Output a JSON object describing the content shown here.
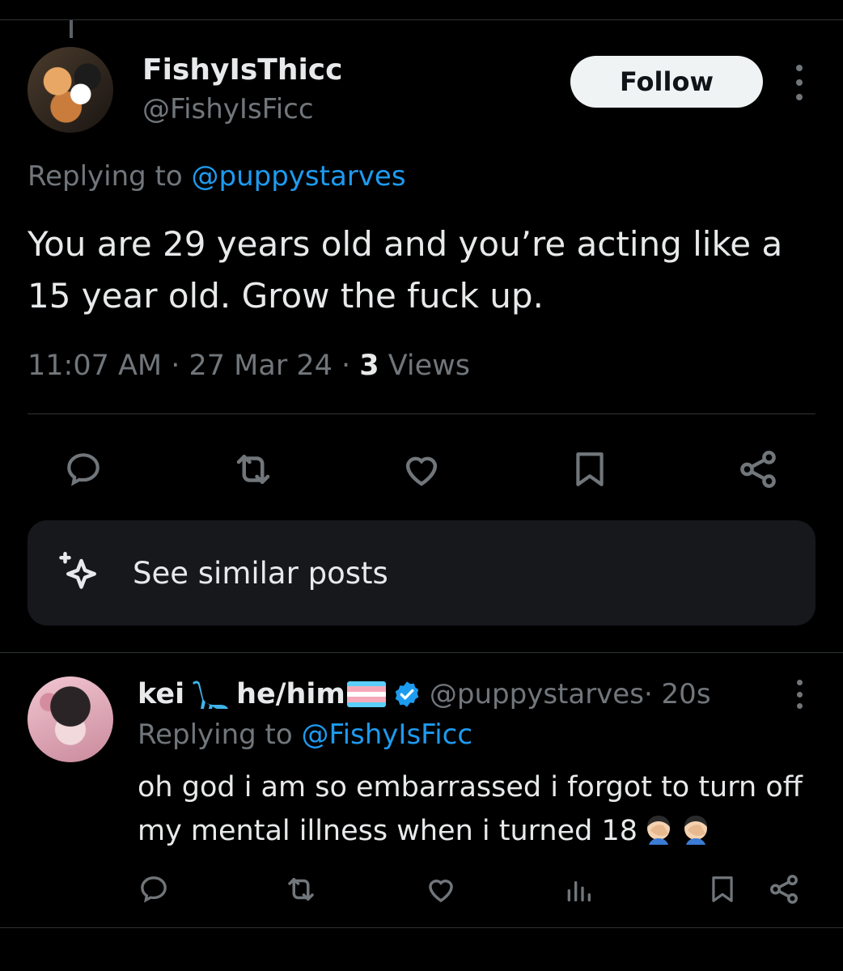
{
  "tweet": {
    "display_name": "FishyIsThicc",
    "handle": "@FishyIsFicc",
    "follow_label": "Follow",
    "replying_prefix": "Replying to ",
    "replying_to": "@puppystarves",
    "text": "You are 29 years old and you’re acting like a 15 year old. Grow the fuck up.",
    "time": "11:07 AM · 27 Mar 24 · ",
    "views_count": "3",
    "views_label": " Views"
  },
  "actions": {
    "icons": [
      "reply-icon",
      "retweet-icon",
      "like-icon",
      "bookmark-icon",
      "share-icon"
    ]
  },
  "similar": {
    "label": "See similar posts",
    "icon": "sparkle-icon"
  },
  "reply": {
    "name": "kei",
    "pronouns": "he/him",
    "handle": "@puppystarves",
    "age": " · 20s",
    "replying_prefix": "Replying to ",
    "replying_to": "@FishyIsFicc",
    "text": "oh god i am so embarrassed i forgot to turn off my mental illness when i turned 18",
    "emojis": [
      "face-palm-emoji",
      "face-palm-emoji"
    ],
    "action_icons": [
      "reply-icon",
      "retweet-icon",
      "like-icon",
      "analytics-icon",
      "bookmark-icon",
      "share-icon"
    ]
  },
  "colors": {
    "background": "#000000",
    "text": "#e7e9ea",
    "muted": "#71767b",
    "link": "#1d9bf0",
    "verified": "#1d9bf0",
    "card": "#16181c"
  }
}
